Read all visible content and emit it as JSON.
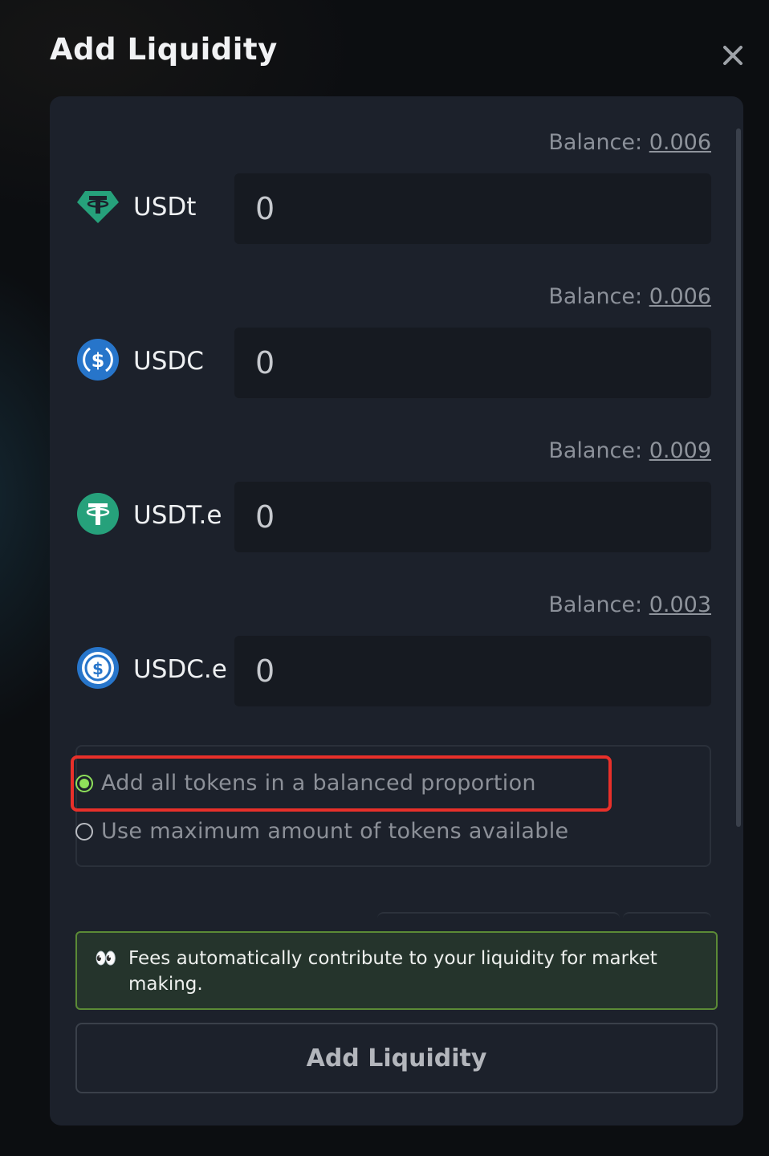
{
  "modal": {
    "title": "Add Liquidity"
  },
  "tokens": [
    {
      "symbol": "USDt",
      "balance_label": "Balance:",
      "balance": "0.006",
      "amount": "0",
      "icon": "tether-diamond-icon",
      "color": "#26a17b"
    },
    {
      "symbol": "USDC",
      "balance_label": "Balance:",
      "balance": "0.006",
      "amount": "0",
      "icon": "usdc-icon",
      "color": "#2775ca"
    },
    {
      "symbol": "USDT.e",
      "balance_label": "Balance:",
      "balance": "0.009",
      "amount": "0",
      "icon": "tether-icon",
      "color": "#26a17b"
    },
    {
      "symbol": "USDC.e",
      "balance_label": "Balance:",
      "balance": "0.003",
      "amount": "0",
      "icon": "usdc-icon",
      "color": "#2775ca"
    }
  ],
  "mode": {
    "options": [
      {
        "label": "Add all tokens in a balanced proportion",
        "selected": true
      },
      {
        "label": "Use maximum amount of tokens available",
        "selected": false
      }
    ]
  },
  "info": {
    "emoji": "👀",
    "text": "Fees automatically contribute to your liquidity for market making."
  },
  "actions": {
    "submit_label": "Add Liquidity"
  },
  "colors": {
    "accent": "#8ee05a",
    "highlight": "#e8302a",
    "info_bg": "#25342c",
    "info_border": "#5b8a36"
  }
}
